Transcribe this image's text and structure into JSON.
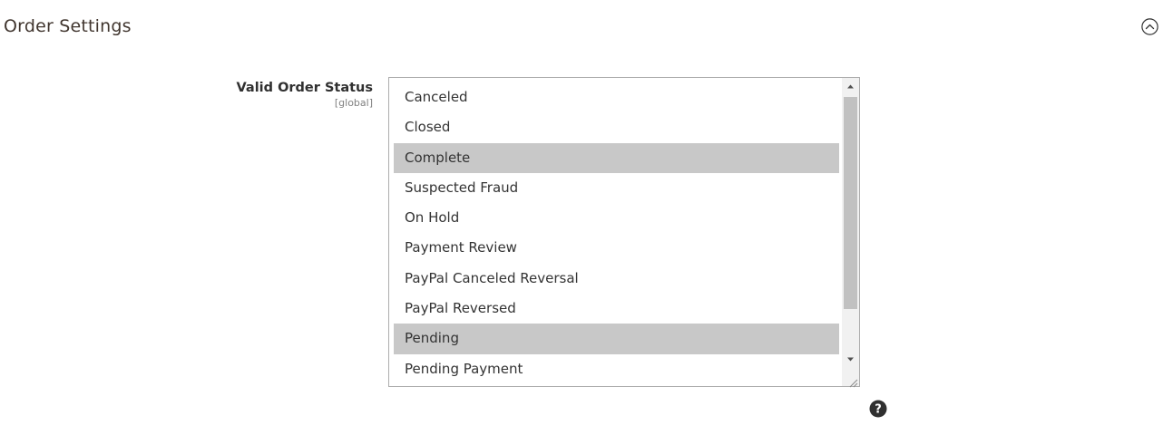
{
  "section": {
    "title": "Order Settings",
    "toggle_icon": "chevron-up-circle-icon"
  },
  "field": {
    "label": "Valid Order Status",
    "scope": "[global]",
    "options": [
      {
        "label": "Canceled",
        "selected": false
      },
      {
        "label": "Closed",
        "selected": false
      },
      {
        "label": "Complete",
        "selected": true
      },
      {
        "label": "Suspected Fraud",
        "selected": false
      },
      {
        "label": "On Hold",
        "selected": false
      },
      {
        "label": "Payment Review",
        "selected": false
      },
      {
        "label": "PayPal Canceled Reversal",
        "selected": false
      },
      {
        "label": "PayPal Reversed",
        "selected": false
      },
      {
        "label": "Pending",
        "selected": true
      },
      {
        "label": "Pending Payment",
        "selected": false
      }
    ],
    "help_icon": "question-circle-icon"
  },
  "colors": {
    "selected_bg": "#c8c8c8",
    "title": "#41362f",
    "border": "#adadad"
  }
}
